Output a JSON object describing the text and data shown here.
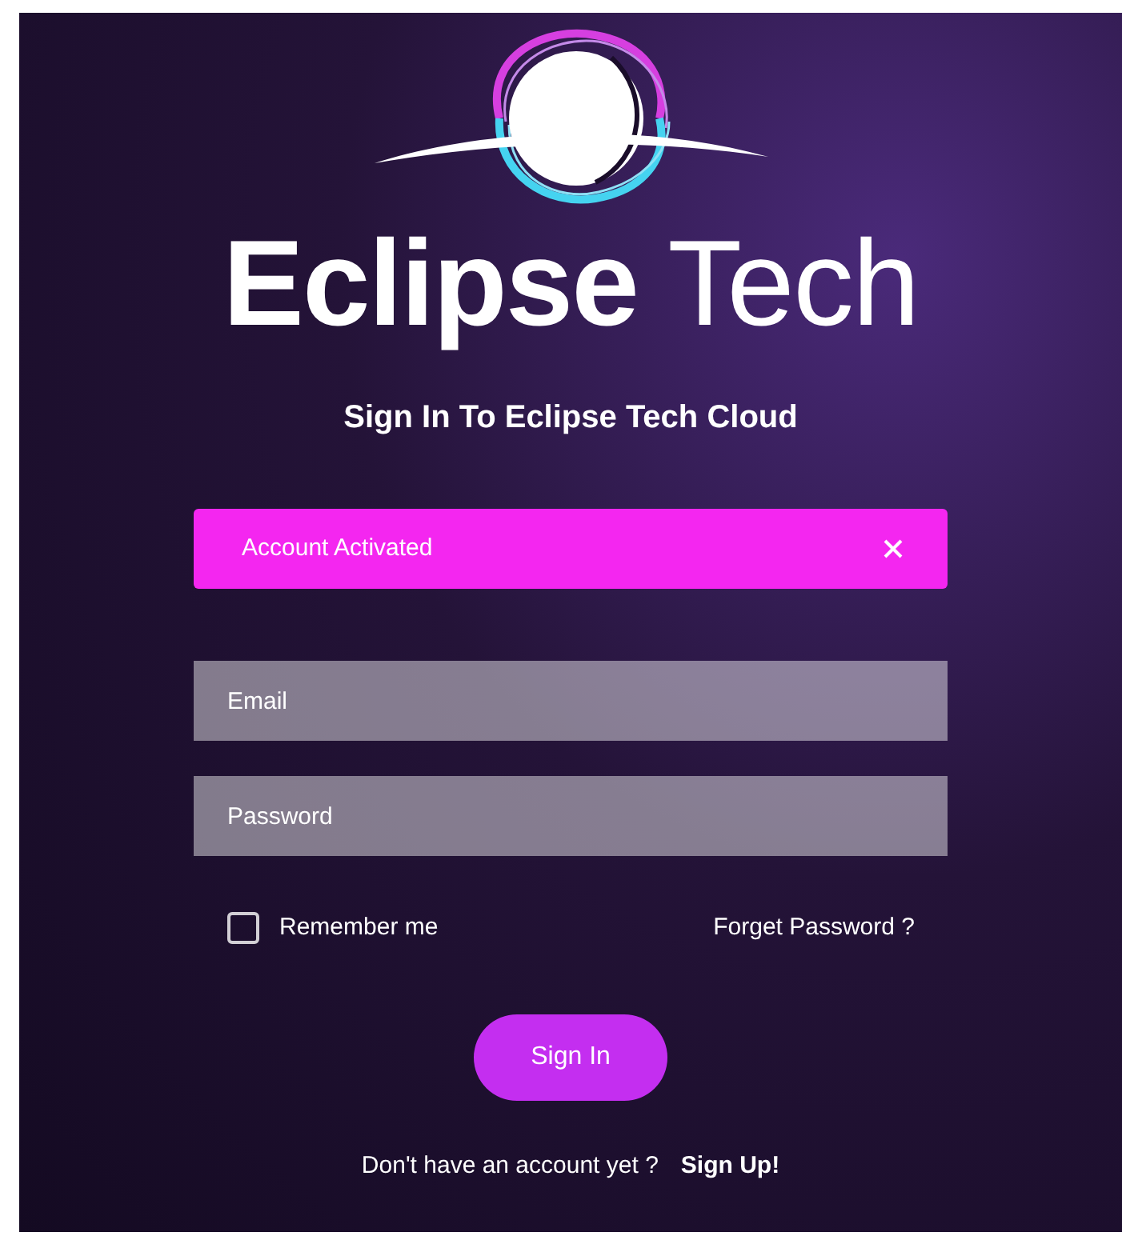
{
  "logo": {
    "wordmark": "**Eclipse** Tech"
  },
  "heading": "Sign In To Eclipse Tech Cloud",
  "alert": {
    "message": "Account Activated"
  },
  "fields": [
    {
      "placeholder": "Email"
    },
    {
      "placeholder": "Password"
    }
  ],
  "remember": {
    "label": "Remember me",
    "checked": false
  },
  "forgot_link": "Forget Password ?",
  "submit": "Sign In",
  "signup": {
    "prompt": "Don't have an account yet ?",
    "link": "Sign Up!"
  }
}
